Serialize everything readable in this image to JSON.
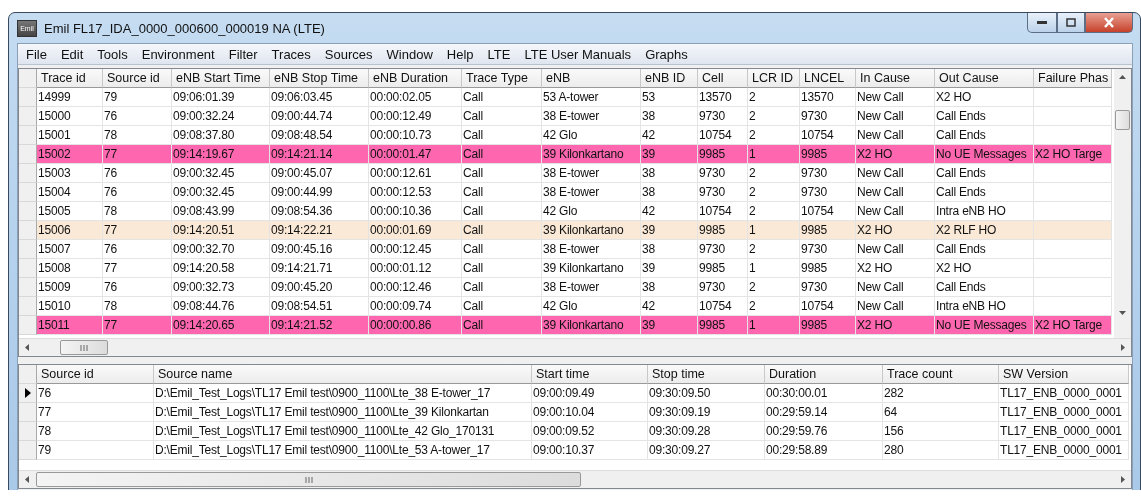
{
  "window": {
    "title": "Emil FL17_IDA_0000_000600_000019 NA  (LTE)",
    "app_icon": "Emil"
  },
  "menu": [
    "File",
    "Edit",
    "Tools",
    "Environment",
    "Filter",
    "Traces",
    "Sources",
    "Window",
    "Help",
    "LTE",
    "LTE User Manuals",
    "Graphs"
  ],
  "traces": {
    "columns": [
      "Trace id",
      "Source id",
      "eNB Start Time",
      "eNB Stop Time",
      "eNB Duration",
      "Trace Type",
      "eNB",
      "eNB ID",
      "Cell",
      "LCR ID",
      "LNCEL",
      "In Cause",
      "Out Cause",
      "Failure Phas"
    ],
    "rows": [
      {
        "cells": [
          "14999",
          "79",
          "09:06:01.39",
          "09:06:03.45",
          "00:00:02.05",
          "Call",
          "53 A-tower",
          "53",
          "13570",
          "2",
          "13570",
          "New Call",
          "X2 HO",
          ""
        ]
      },
      {
        "cells": [
          "15000",
          "76",
          "09:00:32.24",
          "09:00:44.74",
          "00:00:12.49",
          "Call",
          "38 E-tower",
          "38",
          "9730",
          "2",
          "9730",
          "New Call",
          "Call Ends",
          ""
        ]
      },
      {
        "cells": [
          "15001",
          "78",
          "09:08:37.80",
          "09:08:48.54",
          "00:00:10.73",
          "Call",
          "42 Glo",
          "42",
          "10754",
          "2",
          "10754",
          "New Call",
          "Call Ends",
          ""
        ]
      },
      {
        "color": "#ff66b0",
        "cells": [
          "15002",
          "77",
          "09:14:19.67",
          "09:14:21.14",
          "00:00:01.47",
          "Call",
          "39 Kilonkartano",
          "39",
          "9985",
          "1",
          "9985",
          "X2 HO",
          "No UE Messages",
          "X2 HO Targe"
        ]
      },
      {
        "cells": [
          "15003",
          "76",
          "09:00:32.45",
          "09:00:45.07",
          "00:00:12.61",
          "Call",
          "38 E-tower",
          "38",
          "9730",
          "2",
          "9730",
          "New Call",
          "Call Ends",
          ""
        ]
      },
      {
        "cells": [
          "15004",
          "76",
          "09:00:32.45",
          "09:00:44.99",
          "00:00:12.53",
          "Call",
          "38 E-tower",
          "38",
          "9730",
          "2",
          "9730",
          "New Call",
          "Call Ends",
          ""
        ]
      },
      {
        "cells": [
          "15005",
          "78",
          "09:08:43.99",
          "09:08:54.36",
          "00:00:10.36",
          "Call",
          "42 Glo",
          "42",
          "10754",
          "2",
          "10754",
          "New Call",
          "Intra eNB HO",
          ""
        ]
      },
      {
        "color": "#fae9d7",
        "cells": [
          "15006",
          "77",
          "09:14:20.51",
          "09:14:22.21",
          "00:00:01.69",
          "Call",
          "39 Kilonkartano",
          "39",
          "9985",
          "1",
          "9985",
          "X2 HO",
          "X2 RLF HO",
          ""
        ]
      },
      {
        "cells": [
          "15007",
          "76",
          "09:00:32.70",
          "09:00:45.16",
          "00:00:12.45",
          "Call",
          "38 E-tower",
          "38",
          "9730",
          "2",
          "9730",
          "New Call",
          "Call Ends",
          ""
        ]
      },
      {
        "cells": [
          "15008",
          "77",
          "09:14:20.58",
          "09:14:21.71",
          "00:00:01.12",
          "Call",
          "39 Kilonkartano",
          "39",
          "9985",
          "1",
          "9985",
          "X2 HO",
          "X2 HO",
          ""
        ]
      },
      {
        "cells": [
          "15009",
          "76",
          "09:00:32.73",
          "09:00:45.20",
          "00:00:12.46",
          "Call",
          "38 E-tower",
          "38",
          "9730",
          "2",
          "9730",
          "New Call",
          "Call Ends",
          ""
        ]
      },
      {
        "cells": [
          "15010",
          "78",
          "09:08:44.76",
          "09:08:54.51",
          "00:00:09.74",
          "Call",
          "42 Glo",
          "42",
          "10754",
          "2",
          "10754",
          "New Call",
          "Intra eNB HO",
          ""
        ]
      },
      {
        "color": "#ff66b0",
        "cells": [
          "15011",
          "77",
          "09:14:20.65",
          "09:14:21.52",
          "00:00:00.86",
          "Call",
          "39 Kilonkartano",
          "39",
          "9985",
          "1",
          "9985",
          "X2 HO",
          "No UE Messages",
          "X2 HO Targe"
        ]
      }
    ]
  },
  "sources": {
    "columns": [
      "Source id",
      "Source name",
      "Start time",
      "Stop time",
      "Duration",
      "Trace count",
      "SW Version"
    ],
    "rows": [
      {
        "current": true,
        "cells": [
          "76",
          "D:\\Emil_Test_Logs\\TL17 Emil test\\0900_1100\\Lte_38 E-tower_17",
          "09:00:09.49",
          "09:30:09.50",
          "00:30:00.01",
          "282",
          "TL17_ENB_0000_0001"
        ]
      },
      {
        "current": false,
        "cells": [
          "77",
          "D:\\Emil_Test_Logs\\TL17 Emil test\\0900_1100\\Lte_39 Kilonkartan",
          "09:00:10.04",
          "09:30:09.19",
          "00:29:59.14",
          "64",
          "TL17_ENB_0000_0001"
        ]
      },
      {
        "current": false,
        "cells": [
          "78",
          "D:\\Emil_Test_Logs\\TL17 Emil test\\0900_1100\\Lte_42 Glo_170131",
          "09:00:09.52",
          "09:30:09.28",
          "00:29:59.76",
          "156",
          "TL17_ENB_0000_0001"
        ]
      },
      {
        "current": false,
        "cells": [
          "79",
          "D:\\Emil_Test_Logs\\TL17 Emil test\\0900_1100\\Lte_53 A-tower_17",
          "09:00:10.37",
          "09:30:09.27",
          "00:29:58.89",
          "280",
          "TL17_ENB_0000_0001"
        ]
      }
    ]
  }
}
